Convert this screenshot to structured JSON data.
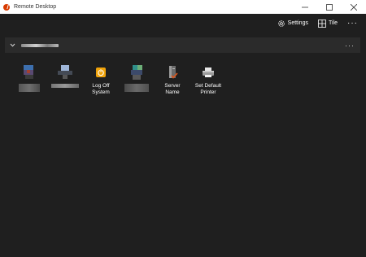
{
  "window": {
    "title": "Remote Desktop",
    "controls": [
      "minimize",
      "maximize",
      "close"
    ]
  },
  "toolbar": {
    "settings_label": "Settings",
    "tile_label": "Tile",
    "more_label": "···"
  },
  "group": {
    "name_redacted": true,
    "more_label": "···"
  },
  "tiles": [
    {
      "label": "",
      "redacted": true,
      "icon": "pixelated-icon"
    },
    {
      "label": "",
      "redacted": true,
      "icon": "pixelated-icon"
    },
    {
      "label": "Log Off\nSystem",
      "icon": "log-off-icon"
    },
    {
      "label": "",
      "redacted": true,
      "icon": "pixelated-icon"
    },
    {
      "label": "Server\nName",
      "icon": "server-icon"
    },
    {
      "label": "Set Default\nPrinter",
      "icon": "printer-icon"
    }
  ],
  "colors": {
    "background": "#1f1f1f",
    "group_bar": "#2b2b2b",
    "accent_red": "#d83b01",
    "logoff_orange": "#f0a30a"
  }
}
